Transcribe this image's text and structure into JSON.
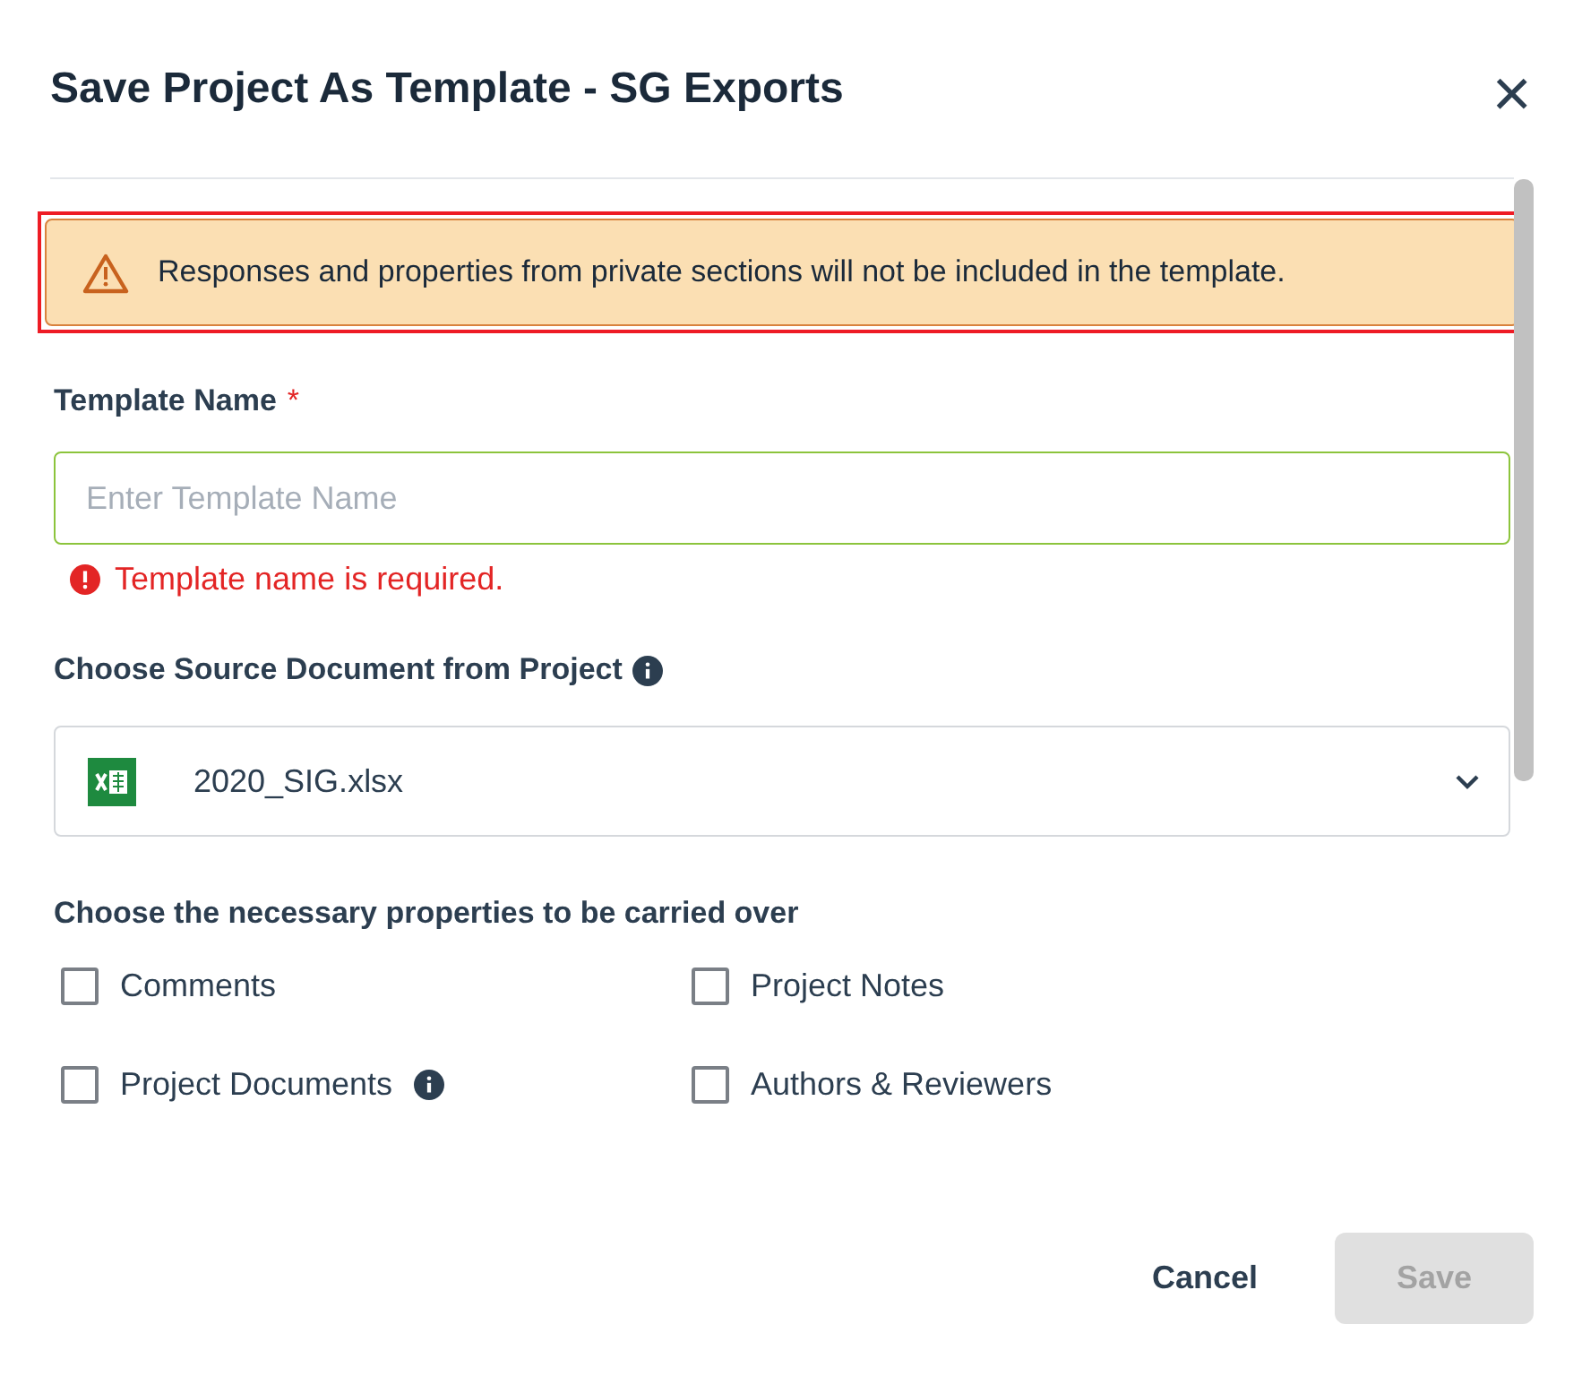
{
  "dialog": {
    "title": "Save Project As Template - SG Exports",
    "close": "×"
  },
  "alert": {
    "text": "Responses and properties from private sections will not be included in the template.",
    "highlighted": true
  },
  "template_name": {
    "label": "Template Name",
    "required": "*",
    "placeholder": "Enter Template Name",
    "error": "Template name is required."
  },
  "source": {
    "label": "Choose Source Document from Project",
    "value": "2020_SIG.xlsx"
  },
  "properties": {
    "label": "Choose the necessary properties to be carried over",
    "options": [
      {
        "label": "Comments",
        "checked": false,
        "info": false
      },
      {
        "label": "Project Notes",
        "checked": false,
        "info": false
      },
      {
        "label": "Project Documents",
        "checked": false,
        "info": true
      },
      {
        "label": "Authors & Reviewers",
        "checked": false,
        "info": false
      }
    ]
  },
  "buttons": {
    "cancel": "Cancel",
    "save": "Save",
    "save_disabled": true
  }
}
